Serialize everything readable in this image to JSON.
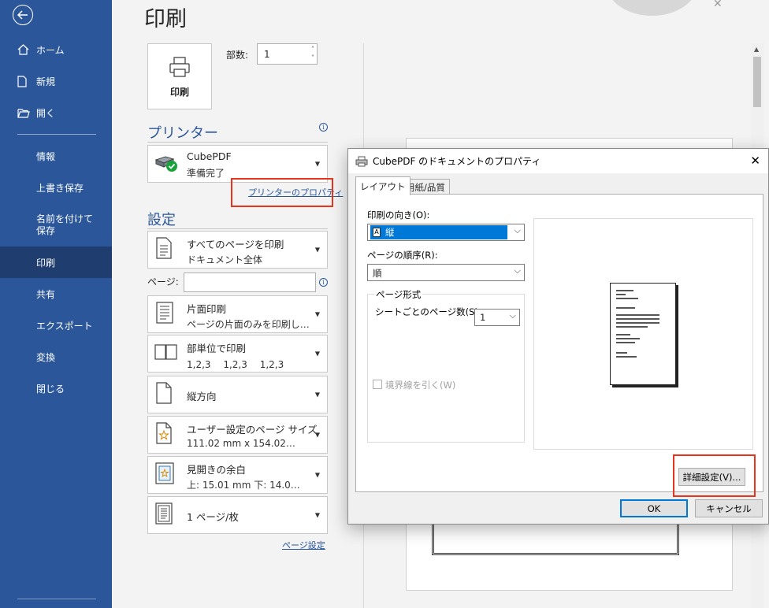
{
  "sidebar": {
    "items": [
      {
        "label": "ホーム"
      },
      {
        "label": "新規"
      },
      {
        "label": "開く"
      },
      {
        "label": "情報"
      },
      {
        "label": "上書き保存"
      },
      {
        "label": "名前を付けて保存"
      },
      {
        "label": "印刷"
      },
      {
        "label": "共有"
      },
      {
        "label": "エクスポート"
      },
      {
        "label": "変換"
      },
      {
        "label": "閉じる"
      }
    ]
  },
  "main": {
    "title": "印刷",
    "print_button": "印刷",
    "copies_label": "部数:",
    "copies_value": "1",
    "printer_section": "プリンター",
    "printer": {
      "name": "CubePDF",
      "status": "準備完了"
    },
    "printer_properties_link": "プリンターのプロパティ",
    "settings_section": "設定",
    "pages_label": "ページ:",
    "pages_value": "",
    "settings": [
      {
        "l1": "すべてのページを印刷",
        "l2": "ドキュメント全体"
      },
      {
        "l1": "片面印刷",
        "l2": "ページの片面のみを印刷し…"
      },
      {
        "l1": "部単位で印刷",
        "l2": "1,2,3　 1,2,3　 1,2,3"
      },
      {
        "l1": "縦方向",
        "l2": ""
      },
      {
        "l1": "ユーザー設定のページ サイズ",
        "l2": "111.02 mm x 154.02…"
      },
      {
        "l1": "見開きの余白",
        "l2": "上: 15.01 mm 下: 14.0…"
      },
      {
        "l1": "1 ページ/枚",
        "l2": ""
      }
    ],
    "page_setup_link": "ページ設定"
  },
  "dialog": {
    "title": "CubePDF のドキュメントのプロパティ",
    "tabs": [
      "レイアウト",
      "用紙/品質"
    ],
    "orientation_label": "印刷の向き(O):",
    "orientation_value": "縦",
    "page_order_label": "ページの順序(R):",
    "page_order_value": "順",
    "page_format_group": "ページ形式",
    "pages_per_sheet_label": "シートごとのページ数(S)",
    "pages_per_sheet_value": "1",
    "draw_borders_label": "境界線を引く(W)",
    "advanced_button": "詳細設定(V)...",
    "ok_button": "OK",
    "cancel_button": "キャンセル"
  },
  "colors": {
    "sidebar_bg": "#2b579a",
    "sidebar_active": "#1f3d6e",
    "accent": "#2b579a",
    "highlight_box": "#e8341c",
    "selection": "#0078d7"
  }
}
